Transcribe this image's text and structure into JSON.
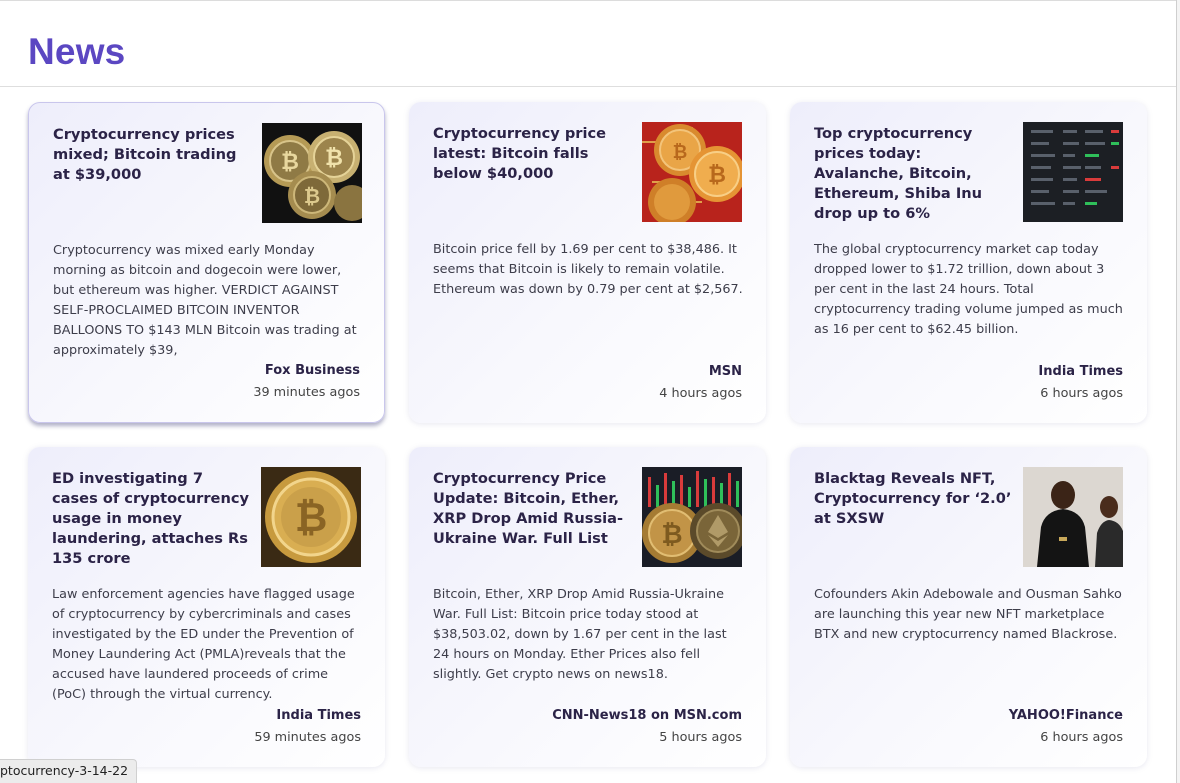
{
  "header": {
    "title": "News"
  },
  "status_bar": {
    "text": "ptocurrency-3-14-22"
  },
  "articles": [
    {
      "title": "Cryptocurrency prices mixed; Bitcoin trading at $39,000",
      "description": "Cryptocurrency was mixed early Monday morning as bitcoin and dogecoin were lower, but ethereum was higher. VERDICT AGAINST SELF-PROCLAIMED BITCOIN INVENTOR BALLOONS TO $143 MLN Bitcoin was trading at approximately $39,",
      "source": "Fox Business",
      "time": "39 minutes agos",
      "image": "bitcoin-coins-dark-image"
    },
    {
      "title": "Cryptocurrency price latest: Bitcoin falls below $40,000",
      "description": "Bitcoin price fell by 1.69 per cent to $38,486. It seems that Bitcoin is likely to remain volatile. Ethereum was down by 0.79 per cent at $2,567.",
      "source": "MSN",
      "time": "4 hours agos",
      "image": "crypto-coins-on-red-circuit-image"
    },
    {
      "title": "Top cryptocurrency prices today: Avalanche, Bitcoin, Ethereum, Shiba Inu drop up to 6%",
      "description": "The global cryptocurrency market cap today dropped lower to $1.72 trillion, down about 3 per cent in the last 24 hours. Total cryptocurrency trading volume jumped as much as 16 per cent to $62.45 billion.",
      "source": "India Times",
      "time": "6 hours agos",
      "image": "stock-ticker-board-image"
    },
    {
      "title": "ED investigating 7 cases of cryptocurrency usage in money laundering, attaches Rs 135 crore",
      "description": "Law enforcement agencies have flagged usage of cryptocurrency by cybercriminals and cases investigated by the ED under the Prevention of Money Laundering Act (PMLA)reveals that the accused have laundered proceeds of crime (PoC) through the virtual currency.",
      "source": "India Times",
      "time": "59 minutes agos",
      "image": "gold-bitcoin-closeup-image"
    },
    {
      "title": "Cryptocurrency Price Update: Bitcoin, Ether, XRP Drop Amid Russia-Ukraine War. Full List",
      "description": "Bitcoin, Ether, XRP Drop Amid Russia-Ukraine War. Full List: Bitcoin price today stood at $38,503.02, down by 1.67 per cent in the last 24 hours on Monday. Ether Prices also fell slightly. Get crypto news on news18.",
      "source": "CNN-News18 on MSN.com",
      "time": "5 hours agos",
      "image": "bitcoin-ether-coins-chart-image"
    },
    {
      "title": "Blacktag Reveals NFT, Cryptocurrency for ‘2.0’ at SXSW",
      "description": "Cofounders Akin Adebowale and Ousman Sahko are launching this year new NFT marketplace BTX and new cryptocurrency named Blackrose.",
      "source": "YAHOO!Finance",
      "time": "6 hours agos",
      "image": "founders-photo-image"
    }
  ]
}
